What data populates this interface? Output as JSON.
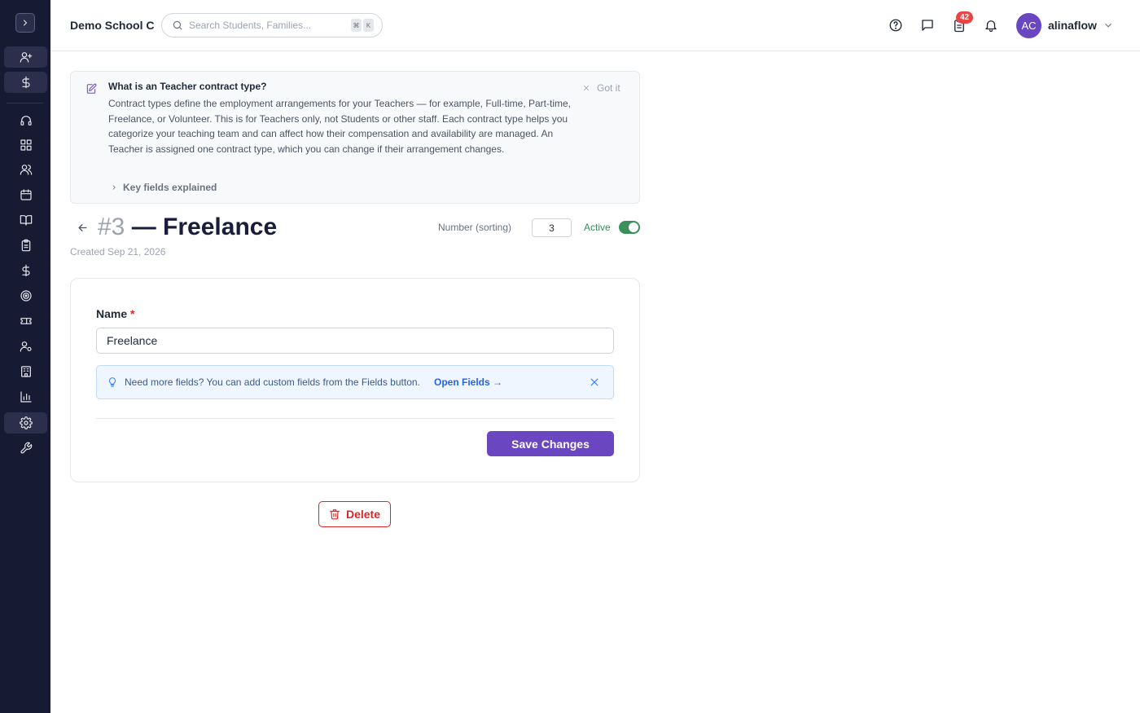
{
  "header": {
    "school_name": "Demo School C",
    "search_placeholder": "Search Students, Families...",
    "kbd_cmd": "⌘",
    "kbd_k": "K",
    "tasks_badge": "42",
    "avatar_initials": "AC",
    "username": "alinaflow"
  },
  "sidebar": {
    "items": [
      {
        "name": "add-user",
        "icon": "user-plus-icon"
      },
      {
        "name": "billing",
        "icon": "dollar-icon"
      },
      {
        "name": "support",
        "icon": "headset-icon"
      },
      {
        "name": "dashboard",
        "icon": "grid-icon"
      },
      {
        "name": "people",
        "icon": "users-icon"
      },
      {
        "name": "calendar",
        "icon": "calendar-icon"
      },
      {
        "name": "courses",
        "icon": "book-icon"
      },
      {
        "name": "assignments",
        "icon": "clipboard-icon"
      },
      {
        "name": "finance",
        "icon": "dollar-icon"
      },
      {
        "name": "goals",
        "icon": "target-icon"
      },
      {
        "name": "tickets",
        "icon": "ticket-icon"
      },
      {
        "name": "staff-settings",
        "icon": "user-gear-icon"
      },
      {
        "name": "organization",
        "icon": "building-icon"
      },
      {
        "name": "reports",
        "icon": "bar-chart-icon"
      },
      {
        "name": "settings",
        "icon": "gear-icon"
      },
      {
        "name": "tools",
        "icon": "wrench-icon"
      }
    ]
  },
  "info": {
    "title": "What is an Teacher contract type?",
    "body": "Contract types define the employment arrangements for your Teachers — for example, Full-time, Part-time, Freelance, or Volunteer. This is for Teachers only, not Students or other staff. Each contract type helps you categorize your teaching team and can affect how their compensation and availability are managed. An Teacher is assigned one contract type, which you can change if their arrangement changes.",
    "dismiss_label": "Got it",
    "key_fields_label": "Key fields explained"
  },
  "record": {
    "number": "#3",
    "title": "— Freelance",
    "created": "Created Sep 21, 2026",
    "sort_label": "Number (sorting)",
    "sort_value": "3",
    "active_label": "Active",
    "active": true
  },
  "form": {
    "name_label": "Name",
    "required_mark": "*",
    "name_value": "Freelance",
    "tip_text": "Need more fields? You can add custom fields from the Fields button.",
    "tip_link": "Open Fields →",
    "save_label": "Save Changes",
    "delete_label": "Delete"
  },
  "colors": {
    "sidebar_bg": "#171a33",
    "accent": "#6b46c1",
    "danger": "#dc2626",
    "active_green": "#3a8f5a"
  }
}
